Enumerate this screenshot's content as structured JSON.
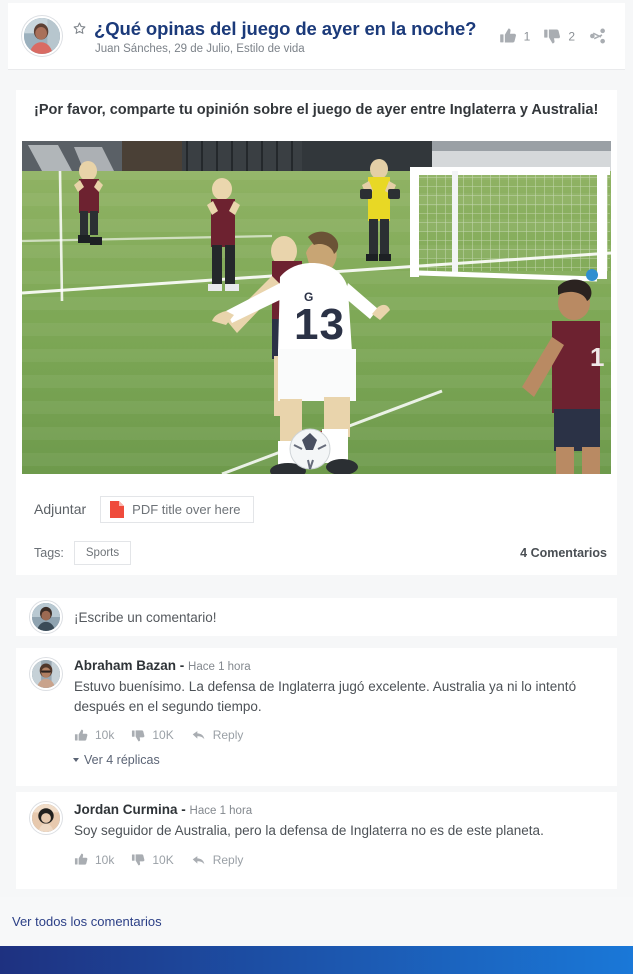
{
  "post": {
    "title": "¿Qué opinas del juego de ayer en la noche?",
    "meta": "Juan Sánches, 29 de Julio, Estilo de vida",
    "star_icon": "star-outline-icon",
    "likes": "1",
    "dislikes": "2",
    "share_icon": "share-icon",
    "subtitle": "¡Por favor, comparte tu opinión sobre el juego de ayer entre Inglaterra y Australia!"
  },
  "attachment": {
    "label": "Adjuntar",
    "file_name": "PDF title over here",
    "icon": "pdf-file-icon",
    "icon_color": "#ef4b3c"
  },
  "tags": {
    "label": "Tags:",
    "items": [
      "Sports"
    ]
  },
  "comments_section": {
    "count_label": "4 Comentarios",
    "compose_placeholder": "¡Escribe un comentario!",
    "view_all_label": "Ver todos los comentarios",
    "items": [
      {
        "author": "Abraham Bazan",
        "separator": "-",
        "time": "Hace 1 hora",
        "text": "Estuvo buenísimo. La defensa de Inglaterra jugó excelente. Australia ya ni lo intentó después en el segundo tiempo.",
        "likes": "10k",
        "dislikes": "10K",
        "reply_label": "Reply",
        "replies_label": "Ver 4 réplicas"
      },
      {
        "author": "Jordan Curmina",
        "separator": "-",
        "time": "Hace 1 hora",
        "text": "Soy seguidor de Australia, pero la defensa de Inglaterra no es de este planeta.",
        "likes": "10k",
        "dislikes": "10K",
        "reply_label": "Reply",
        "replies_label": ""
      }
    ]
  },
  "colors": {
    "title_blue": "#1b3a7a",
    "footer_gradient_start": "#1e3180",
    "footer_gradient_end": "#1a78d8",
    "page_bg": "#f6f7f8"
  }
}
